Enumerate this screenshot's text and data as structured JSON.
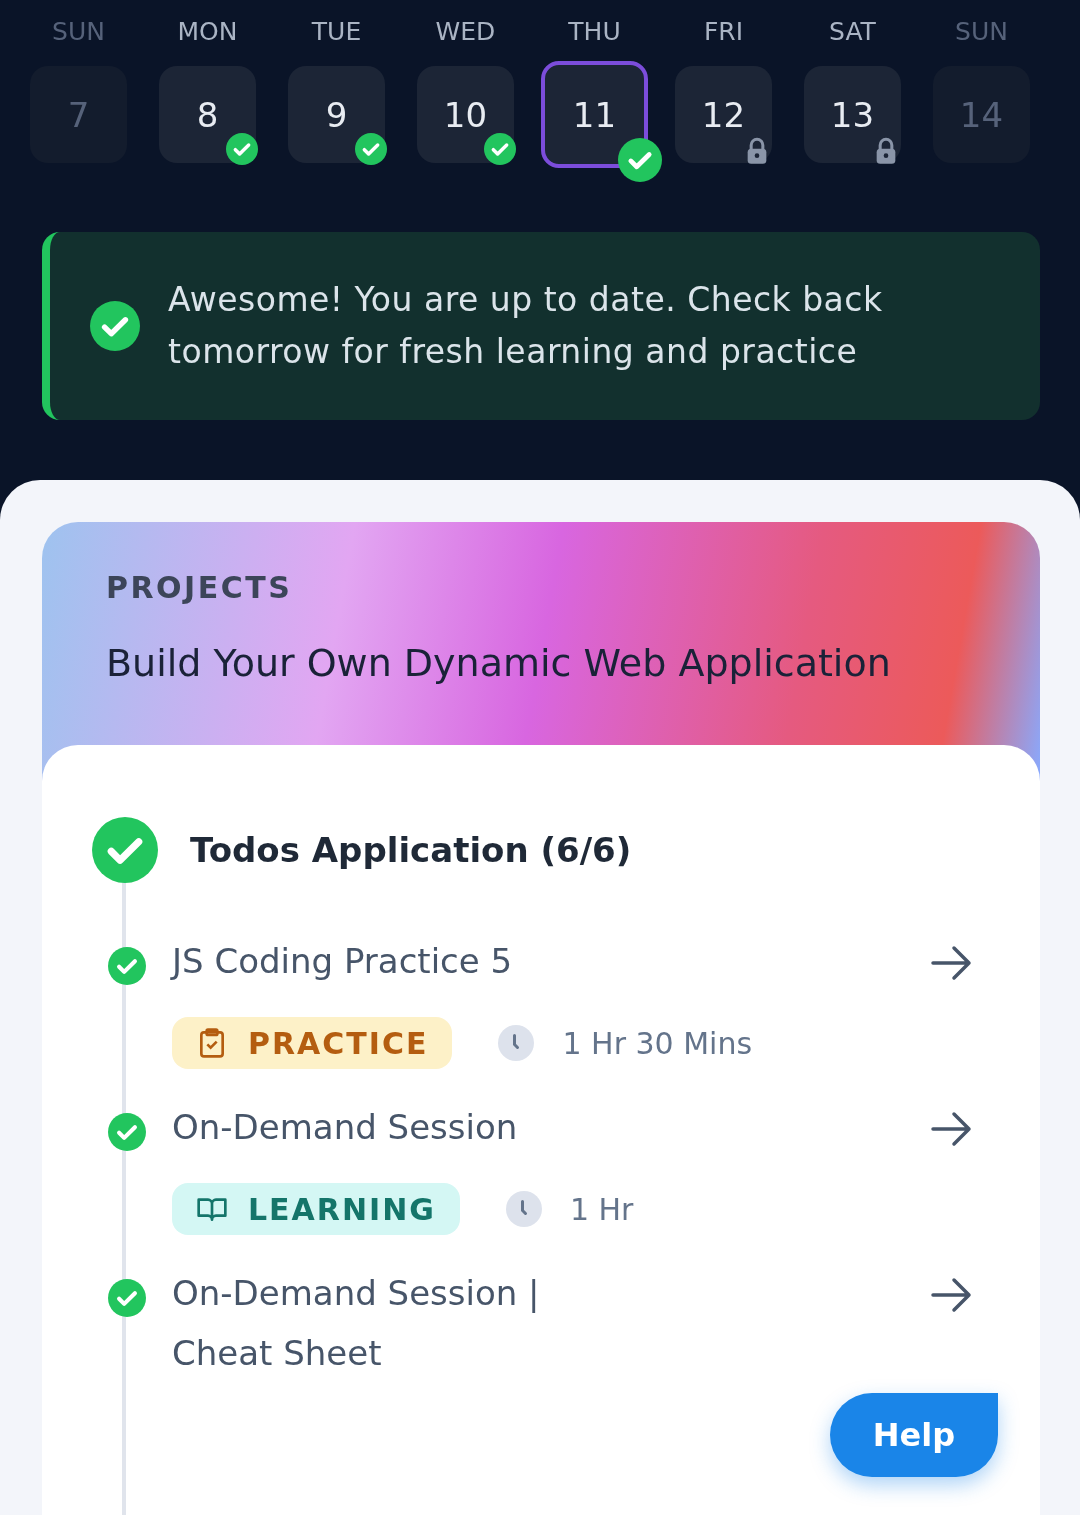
{
  "week": [
    {
      "day": "SUN",
      "date": "7",
      "kind": "plain",
      "faded": true,
      "selected": false
    },
    {
      "day": "MON",
      "date": "8",
      "kind": "done",
      "faded": false,
      "selected": false
    },
    {
      "day": "TUE",
      "date": "9",
      "kind": "done",
      "faded": false,
      "selected": false
    },
    {
      "day": "WED",
      "date": "10",
      "kind": "done",
      "faded": false,
      "selected": false
    },
    {
      "day": "THU",
      "date": "11",
      "kind": "done",
      "faded": false,
      "selected": true
    },
    {
      "day": "FRI",
      "date": "12",
      "kind": "locked",
      "faded": false,
      "selected": false
    },
    {
      "day": "SAT",
      "date": "13",
      "kind": "locked",
      "faded": false,
      "selected": false
    },
    {
      "day": "SUN",
      "date": "14",
      "kind": "plain",
      "faded": true,
      "selected": false
    }
  ],
  "banner": {
    "message": "Awesome! You are up to date. Check back tomorrow for fresh learning and practice"
  },
  "project": {
    "category": "PROJECTS",
    "title": "Build Your Own Dynamic Web Application"
  },
  "timeline": [
    {
      "kind": "module",
      "title": "Todos Application (6/6)",
      "completed": true
    },
    {
      "kind": "step",
      "title": "JS Coding Practice 5",
      "completed": true,
      "tag": {
        "kind": "practice",
        "label": "PRACTICE"
      },
      "duration": "1 Hr 30 Mins"
    },
    {
      "kind": "step",
      "title": "On-Demand Session",
      "completed": true,
      "tag": {
        "kind": "learning",
        "label": "LEARNING"
      },
      "duration": "1 Hr"
    },
    {
      "kind": "step",
      "title": "On-Demand Session | Cheat Sheet",
      "completed": true
    }
  ],
  "help": {
    "label": "Help"
  }
}
